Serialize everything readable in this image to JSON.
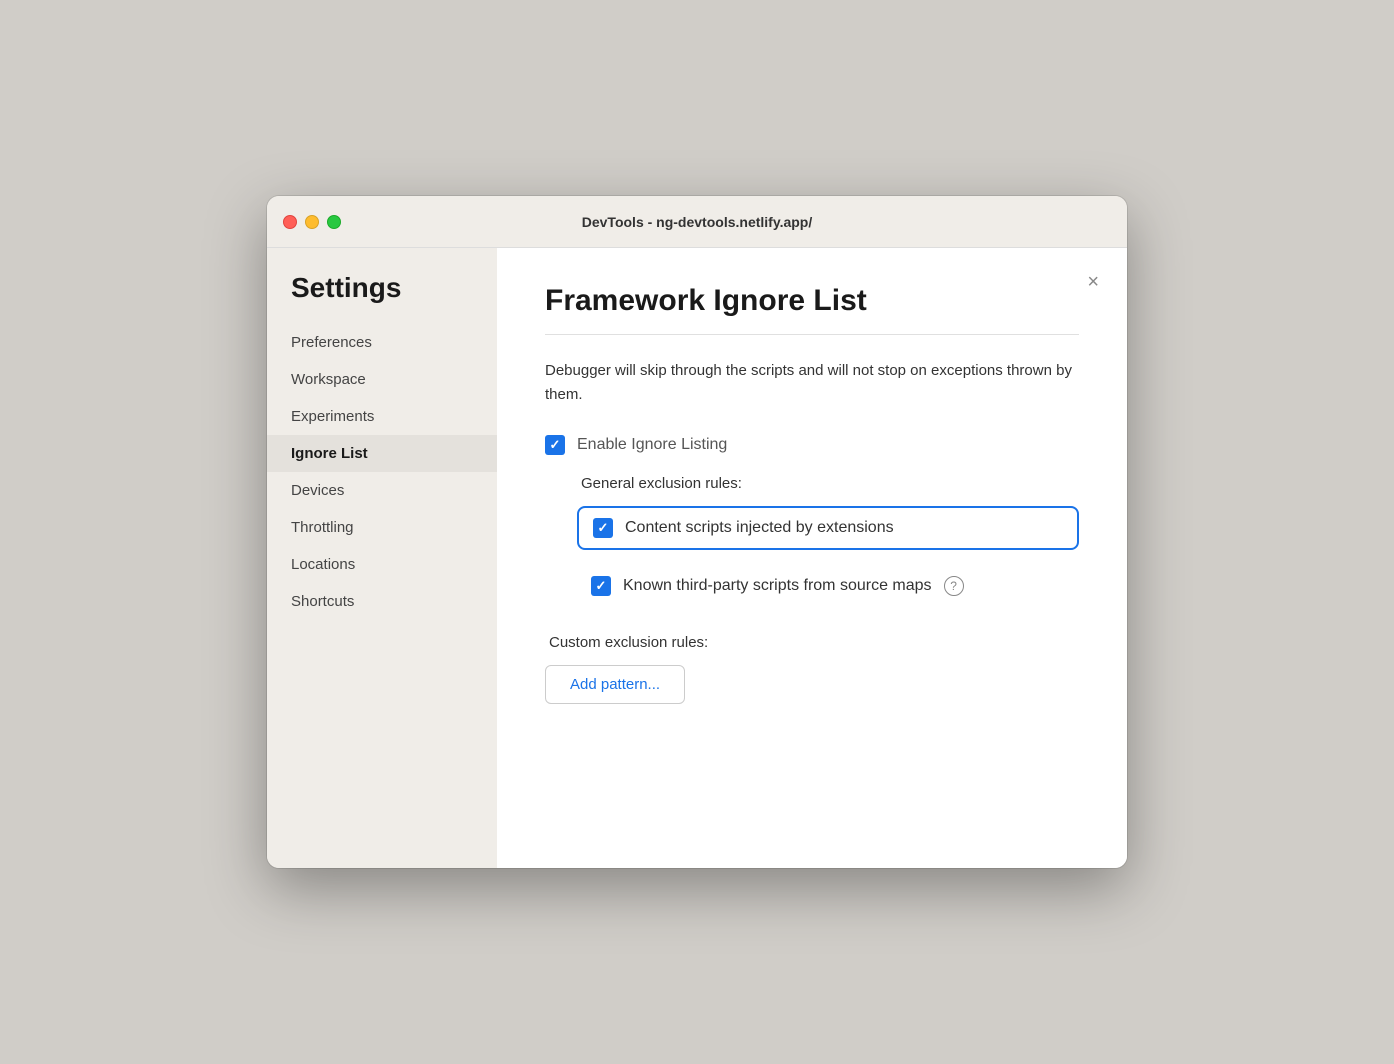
{
  "titlebar": {
    "title": "DevTools - ng-devtools.netlify.app/"
  },
  "sidebar": {
    "heading": "Settings",
    "items": [
      {
        "id": "preferences",
        "label": "Preferences",
        "active": false
      },
      {
        "id": "workspace",
        "label": "Workspace",
        "active": false
      },
      {
        "id": "experiments",
        "label": "Experiments",
        "active": false
      },
      {
        "id": "ignore-list",
        "label": "Ignore List",
        "active": true
      },
      {
        "id": "devices",
        "label": "Devices",
        "active": false
      },
      {
        "id": "throttling",
        "label": "Throttling",
        "active": false
      },
      {
        "id": "locations",
        "label": "Locations",
        "active": false
      },
      {
        "id": "shortcuts",
        "label": "Shortcuts",
        "active": false
      }
    ]
  },
  "panel": {
    "title": "Framework Ignore List",
    "description": "Debugger will skip through the scripts and will not stop on exceptions thrown by them.",
    "enable_ignore_listing_label": "Enable Ignore Listing",
    "general_exclusion_rules_label": "General exclusion rules:",
    "rules": [
      {
        "id": "content-scripts",
        "label": "Content scripts injected by extensions",
        "checked": true,
        "highlighted": true,
        "has_help": false
      },
      {
        "id": "third-party-scripts",
        "label": "Known third-party scripts from source maps",
        "checked": true,
        "highlighted": false,
        "has_help": true
      }
    ],
    "custom_exclusion_rules_label": "Custom exclusion rules:",
    "add_pattern_button_label": "Add pattern...",
    "close_button_label": "×"
  },
  "traffic_lights": {
    "close_color": "#ff5f57",
    "minimize_color": "#febc2e",
    "maximize_color": "#28c840"
  }
}
